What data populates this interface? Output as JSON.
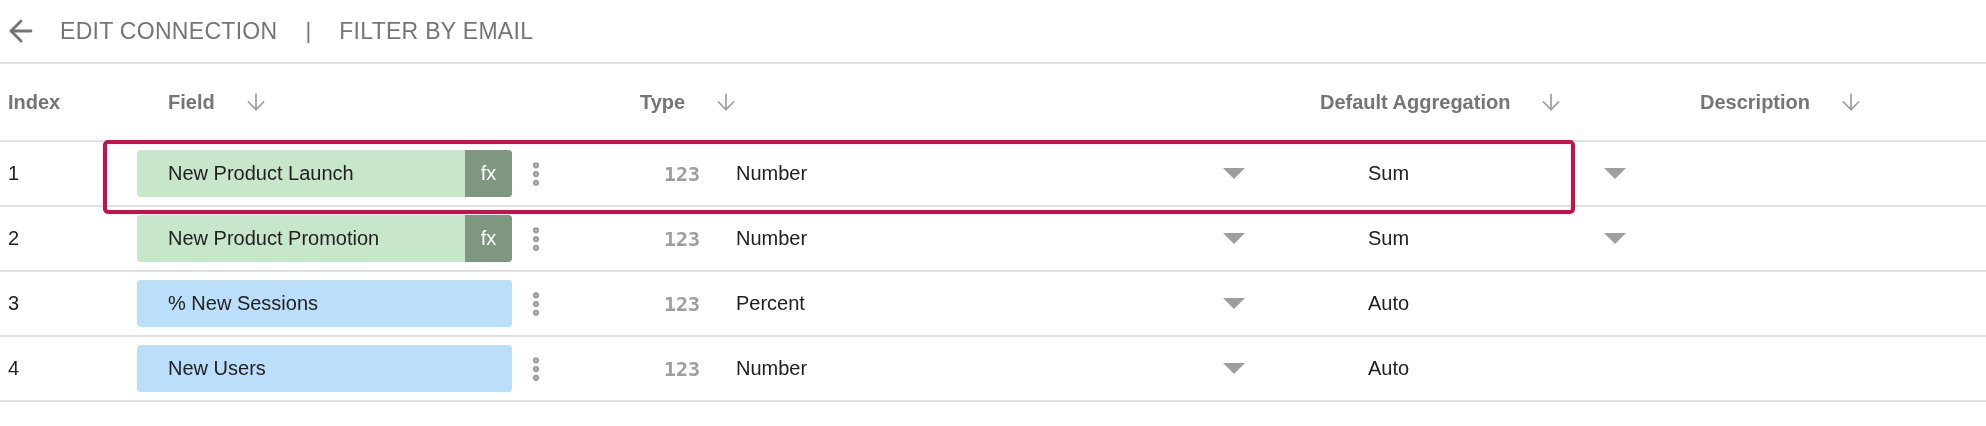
{
  "breadcrumb": {
    "items": [
      "EDIT CONNECTION",
      "FILTER BY EMAIL"
    ],
    "separator": "|"
  },
  "columns": [
    {
      "label": "Index",
      "sortable": false
    },
    {
      "label": "Field",
      "sortable": true
    },
    {
      "label": "Type",
      "sortable": true
    },
    {
      "label": "Default Aggregation",
      "sortable": true
    },
    {
      "label": "Description",
      "sortable": true
    }
  ],
  "rows": [
    {
      "index": "1",
      "field": "New Product Launch",
      "kind": "calculated",
      "badge": "fx",
      "type_glyph": "123",
      "type": "Number",
      "aggregation": "Sum",
      "aggregation_editable": true,
      "highlighted": true
    },
    {
      "index": "2",
      "field": "New Product Promotion",
      "kind": "calculated",
      "badge": "fx",
      "type_glyph": "123",
      "type": "Number",
      "aggregation": "Sum",
      "aggregation_editable": true,
      "highlighted": false
    },
    {
      "index": "3",
      "field": "% New Sessions",
      "kind": "metric",
      "type_glyph": "123",
      "type": "Percent",
      "aggregation": "Auto",
      "aggregation_editable": false,
      "highlighted": false
    },
    {
      "index": "4",
      "field": "New Users",
      "kind": "metric",
      "type_glyph": "123",
      "type": "Number",
      "aggregation": "Auto",
      "aggregation_editable": false,
      "highlighted": false
    }
  ]
}
